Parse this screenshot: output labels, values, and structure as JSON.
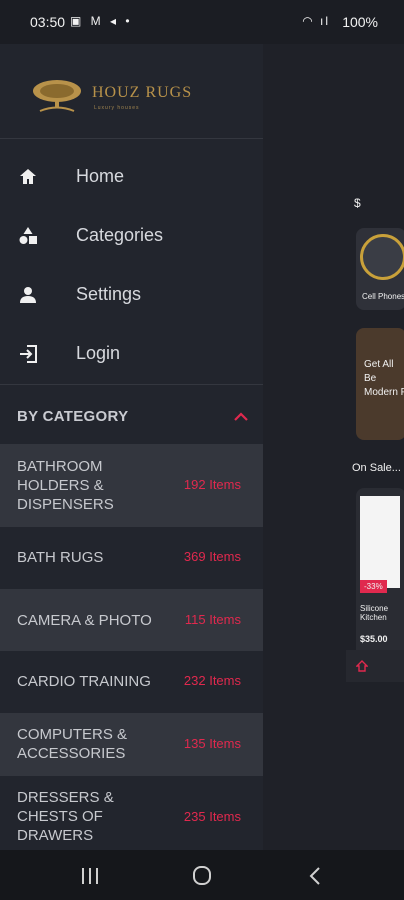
{
  "status_bar": {
    "time": "03:50",
    "left_icons": "▣ M ◂ •",
    "right_icons": "◠ ıl",
    "battery": "100%"
  },
  "brand": {
    "name": "HOUZ RUGS",
    "tagline": "Luxury houses",
    "color": "#b8924a"
  },
  "nav": [
    {
      "label": "Home",
      "icon": "home-icon"
    },
    {
      "label": "Categories",
      "icon": "categories-icon"
    },
    {
      "label": "Settings",
      "icon": "person-icon"
    },
    {
      "label": "Login",
      "icon": "login-icon"
    }
  ],
  "category_section": {
    "title": "BY CATEGORY",
    "items": [
      {
        "name": "Bathroom Holders & Dispensers",
        "count": "192 Items"
      },
      {
        "name": "Bath Rugs",
        "count": "369 Items"
      },
      {
        "name": "Camera & Photo",
        "count": "115 Items"
      },
      {
        "name": "Cardio Training",
        "count": "232 Items"
      },
      {
        "name": "Computers & Accessories",
        "count": "135 Items"
      },
      {
        "name": "Dressers & Chests of Drawers",
        "count": "235 Items"
      }
    ]
  },
  "background_app": {
    "cell_phones": "Cell Phones",
    "banner": "Get All Be Modern F",
    "on_sale": "On Sale...",
    "badge": "-33%",
    "product": "Silicone Kitchen",
    "price": "$35.00"
  },
  "colors": {
    "accent": "#e0294e",
    "drawer_bg": "#22252d",
    "row_alt": "#33363e"
  }
}
